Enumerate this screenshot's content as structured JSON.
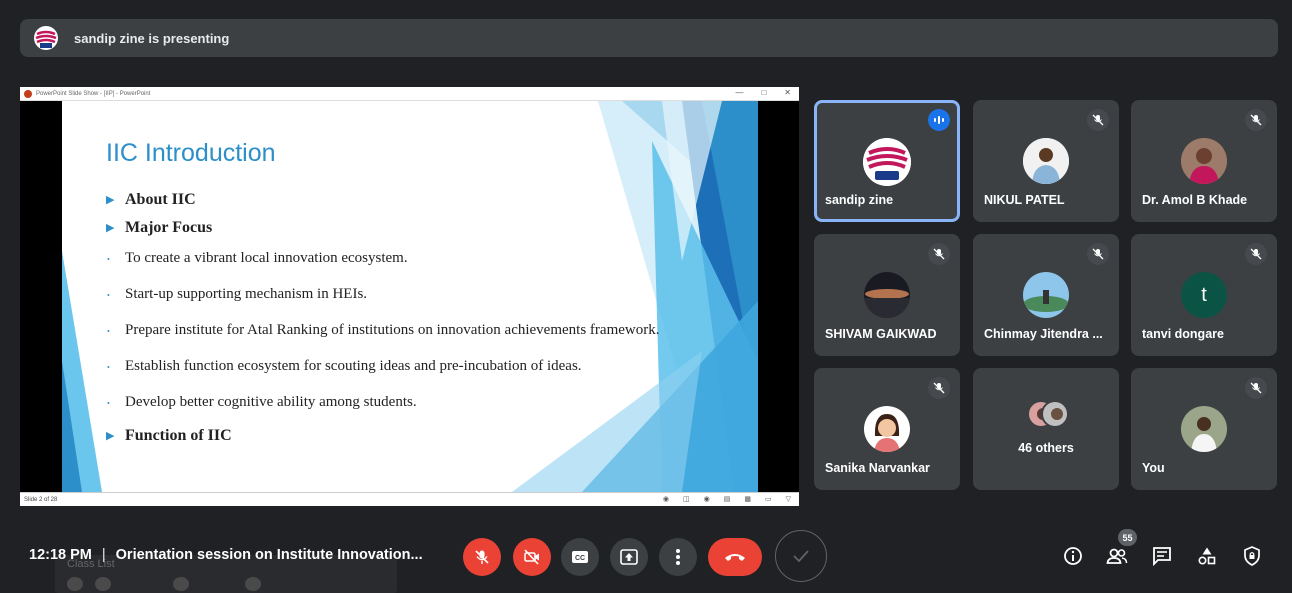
{
  "banner": {
    "presenter_text": "sandip zine is presenting"
  },
  "powerpoint": {
    "window_title": "PowerPoint Slide Show - [IIP] - PowerPoint",
    "status_left": "Slide 2 of 28"
  },
  "slide": {
    "title": "IIC Introduction",
    "heading_about": "About IIC",
    "heading_focus": "Major Focus",
    "items": [
      "To create a vibrant local innovation ecosystem.",
      "Start-up supporting mechanism in HEIs.",
      "Prepare institute for Atal Ranking of institutions on innovation achievements framework.",
      "Establish function ecosystem for scouting ideas and pre-incubation of ideas.",
      "Develop better cognitive ability among students."
    ],
    "heading_function": "Function of IIC"
  },
  "participants": [
    {
      "name": "sandip zine",
      "speaking": true,
      "avatar": "zine-logo"
    },
    {
      "name": "NIKUL PATEL",
      "muted": true,
      "avatar": "photo"
    },
    {
      "name": "Dr. Amol B Khade",
      "muted": true,
      "avatar": "photo"
    },
    {
      "name": "SHIVAM GAIKWAD",
      "muted": true,
      "avatar": "photo"
    },
    {
      "name": "Chinmay Jitendra ...",
      "muted": true,
      "avatar": "photo"
    },
    {
      "name": "tanvi dongare",
      "muted": true,
      "avatar_letter": "t"
    },
    {
      "name": "Sanika Narvankar",
      "muted": true,
      "avatar": "photo"
    },
    {
      "name": "46 others"
    },
    {
      "name": "You",
      "muted": true,
      "avatar": "photo"
    }
  ],
  "bottom": {
    "time": "12:18 PM",
    "separator": "|",
    "meeting_title": "Orientation session on Institute Innovation...",
    "ghost_label": "Class List",
    "people_count": "55"
  },
  "colors": {
    "end_call": "#ea4335",
    "accent": "#1a73e8",
    "tile_bg": "#3c4043",
    "page_bg": "#202124",
    "slide_title": "#2c8fc9"
  }
}
